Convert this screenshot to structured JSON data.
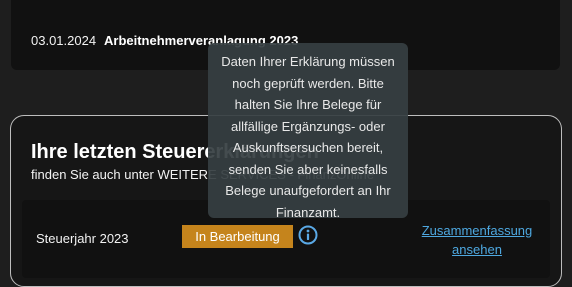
{
  "top_card": {
    "date": "03.01.2024",
    "title": "Arbeitnehmerveranlagung 2023"
  },
  "panel": {
    "title": "Ihre letzten Steuererklärungen",
    "subtitle_prefix": "finden Sie auch unter ",
    "subtitle_highlight": "WEITERE SERVICES - FinanzOnline",
    "year_row": {
      "label": "Steuerjahr 2023",
      "status": "In Bearbeitung",
      "link_line1": "Zusammenfassung",
      "link_line2": "ansehen"
    }
  },
  "tooltip": {
    "lines": [
      "Daten Ihrer Erklärung müssen",
      "noch geprüft werden. Bitte",
      "halten Sie Ihre Belege für",
      "allfällige Ergänzungs- oder",
      "Auskunftsersuchen bereit,",
      "senden Sie aber keinesfalls",
      "Belege unaufgefordert an Ihr",
      "Finanzamt."
    ]
  },
  "colors": {
    "badge": "#c5841c",
    "link": "#4ea8e0",
    "info_icon": "#5aa9e6"
  },
  "icons": {
    "info": "info-circle-icon"
  }
}
